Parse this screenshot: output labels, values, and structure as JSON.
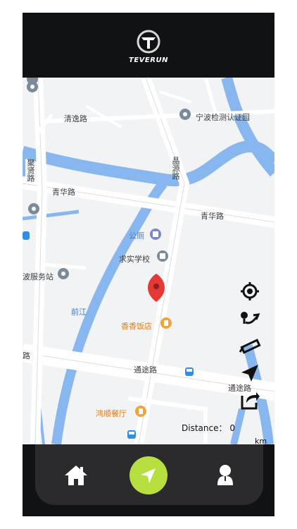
{
  "app": {
    "brand": "TEVERUN",
    "accent_color": "#b6df3f"
  },
  "map": {
    "labels": {
      "qingyi_road": "清逸路",
      "inspection_park": "宁波检测认证园",
      "juxian_road": "聚贤路",
      "qinghua_road_left": "青华路",
      "qinghua_road_right": "青华路",
      "public_toilet": "公厕",
      "qiushi_school": "求实学校",
      "service_station": "波服务站",
      "qianjiang": "前江",
      "xiangxiang_restaurant": "香香饭店",
      "tongtu_road_mid": "通途路",
      "tongtu_road_right": "通途路",
      "hongshun_restaurant": "鸿顺餐厅",
      "jingyuan_road": "晶源路",
      "road_edge": "路"
    },
    "marker": "red-location-pin"
  },
  "tools": {
    "icons": [
      "locate-target-icon",
      "route-icon",
      "ruler-icon",
      "navigation-arrow-icon",
      "share-icon"
    ]
  },
  "status": {
    "distance_label": "Distance：",
    "distance_value": "0",
    "unit": "km"
  },
  "nav": {
    "items": [
      "home-icon",
      "map-navigation-icon",
      "user-icon"
    ]
  }
}
